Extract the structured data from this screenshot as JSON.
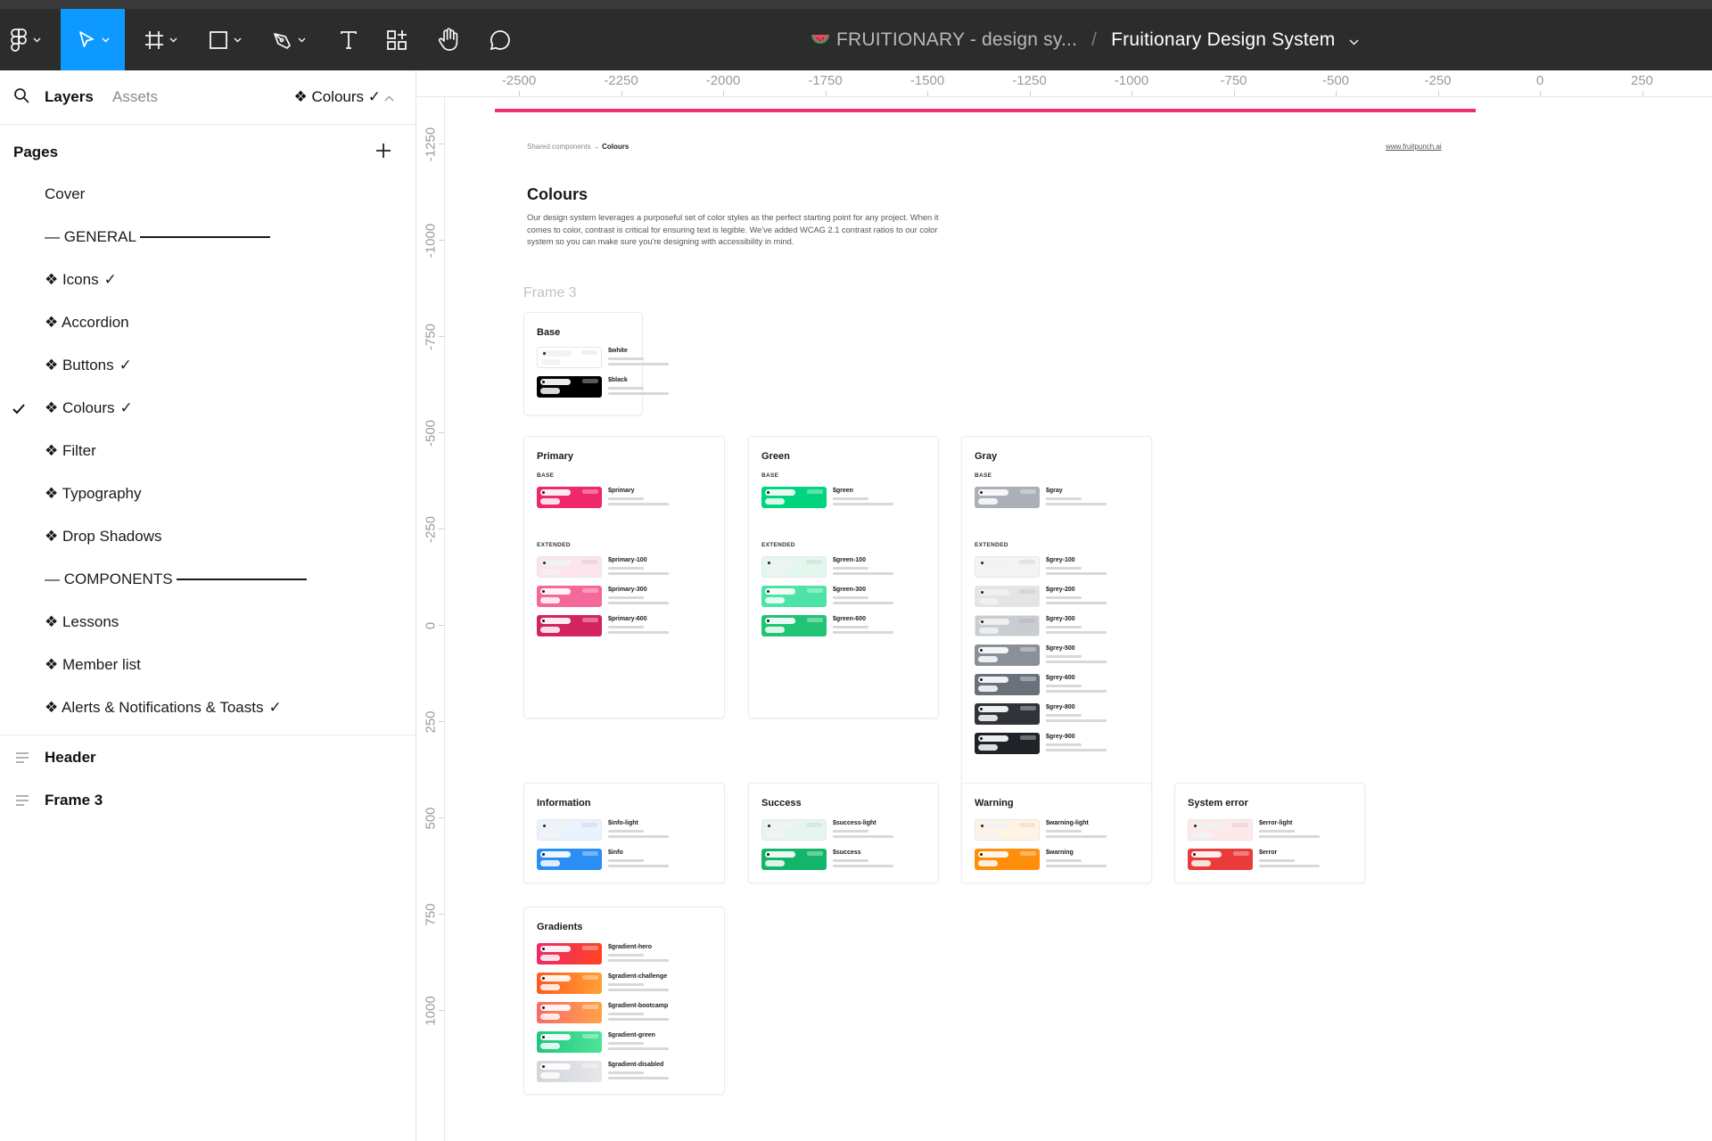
{
  "toolbar": {
    "file_title": {
      "project": "FRUITIONARY - design sy...",
      "separator": "/",
      "document": "Fruitionary Design System"
    },
    "tools": [
      "main-menu",
      "move",
      "frame",
      "shape",
      "pen",
      "text",
      "resources",
      "hand",
      "comment"
    ],
    "active_tool": "move"
  },
  "sidebar": {
    "tabs": {
      "layers": "Layers",
      "assets": "Assets"
    },
    "current_page": "❖ Colours ✓",
    "pages_heading": "Pages",
    "pages": [
      {
        "label": "Cover"
      },
      {
        "label": "— GENERAL"
      },
      {
        "label": "❖ Icons",
        "tick": "✓"
      },
      {
        "label": "❖ Accordion"
      },
      {
        "label": "❖ Buttons",
        "tick": "✓"
      },
      {
        "label": "❖ Colours",
        "tick": "✓",
        "selected": true
      },
      {
        "label": "❖ Filter"
      },
      {
        "label": "❖ Typography"
      },
      {
        "label": "❖ Drop Shadows"
      },
      {
        "label": "— COMPONENTS"
      },
      {
        "label": "❖ Lessons"
      },
      {
        "label": "❖ Member list"
      },
      {
        "label": "❖ Alerts & Notifications & Toasts",
        "tick": "✓"
      }
    ],
    "layers": [
      "Header",
      "Frame 3"
    ]
  },
  "rulers": {
    "top": [
      "-2500",
      "-2250",
      "-2000",
      "-1750",
      "-1500",
      "-1250",
      "-1000",
      "-750",
      "-500",
      "-250",
      "0",
      "250"
    ],
    "left": [
      "-1250",
      "-1000",
      "-750",
      "-500",
      "-250",
      "0",
      "250",
      "500",
      "750",
      "1000"
    ]
  },
  "canvas": {
    "breadcrumb": {
      "parent": "Shared components",
      "arrow": "→",
      "current": "Colours"
    },
    "site_link": "www.fruitpunch.ai",
    "title": "Colours",
    "description": "Our design system leverages a purposeful set of color styles as the perfect starting point for any project. When it comes to color, contrast is critical for ensuring text is legible. We've added WCAG 2.1 contrast ratios to our color system so you can make sure you're designing with accessibility in mind.",
    "frame_label": "Frame 3",
    "accent_color": "#ef2f73",
    "subheads": {
      "base": "BASE",
      "extended": "EXTENDED"
    },
    "cards": {
      "base": {
        "title": "Base",
        "swatches": [
          {
            "name": "$white",
            "color": "#ffffff"
          },
          {
            "name": "$black",
            "color": "#000000"
          }
        ]
      },
      "primary": {
        "title": "Primary",
        "base": [
          {
            "name": "$primary",
            "color": "#ee2869"
          }
        ],
        "extended": [
          {
            "name": "$primary-100",
            "color": "#fde4ec"
          },
          {
            "name": "$primary-300",
            "color": "#f4689a"
          },
          {
            "name": "$primary-600",
            "color": "#d4245e"
          }
        ]
      },
      "green": {
        "title": "Green",
        "base": [
          {
            "name": "$green",
            "color": "#00d47e"
          }
        ],
        "extended": [
          {
            "name": "$green-100",
            "color": "#e2f8ef"
          },
          {
            "name": "$green-300",
            "color": "#4de3a6"
          },
          {
            "name": "$green-600",
            "color": "#20c474"
          }
        ]
      },
      "gray": {
        "title": "Gray",
        "base": [
          {
            "name": "$gray",
            "color": "#abafb7"
          }
        ],
        "extended": [
          {
            "name": "$grey-100",
            "color": "#f3f3f4"
          },
          {
            "name": "$grey-200",
            "color": "#e3e4e6"
          },
          {
            "name": "$grey-300",
            "color": "#c9ccd1"
          },
          {
            "name": "$grey-500",
            "color": "#8a9099"
          },
          {
            "name": "$grey-600",
            "color": "#6b717b"
          },
          {
            "name": "$grey-800",
            "color": "#30343a"
          },
          {
            "name": "$grey-900",
            "color": "#1f2226"
          }
        ]
      },
      "information": {
        "title": "Information",
        "swatches": [
          {
            "name": "$info-light",
            "color": "#e9f3ff"
          },
          {
            "name": "$info",
            "color": "#2a8ff5"
          }
        ]
      },
      "success": {
        "title": "Success",
        "swatches": [
          {
            "name": "$success-light",
            "color": "#e6f6ee"
          },
          {
            "name": "$success",
            "color": "#13b56a"
          }
        ]
      },
      "warning": {
        "title": "Warning",
        "swatches": [
          {
            "name": "$warning-light",
            "color": "#fff4e4"
          },
          {
            "name": "$warning",
            "color": "#ff8f0b"
          }
        ]
      },
      "system_error": {
        "title": "System error",
        "swatches": [
          {
            "name": "$error-light",
            "color": "#fde9e9"
          },
          {
            "name": "$error",
            "color": "#ea3a3a"
          }
        ]
      },
      "gradients": {
        "title": "Gradients",
        "swatches": [
          {
            "name": "$gradient-hero",
            "from": "#ee2869",
            "to": "#ff4423"
          },
          {
            "name": "$gradient-challenge",
            "from": "#ff5a1f",
            "to": "#ffa135"
          },
          {
            "name": "$gradient-bootcamp",
            "from": "#f96a6a",
            "to": "#ffa247"
          },
          {
            "name": "$gradient-green",
            "from": "#1dc77c",
            "to": "#50e39a"
          },
          {
            "name": "$gradient-disabled",
            "from": "#d2d5da",
            "to": "#e5e7ea"
          }
        ]
      }
    }
  }
}
